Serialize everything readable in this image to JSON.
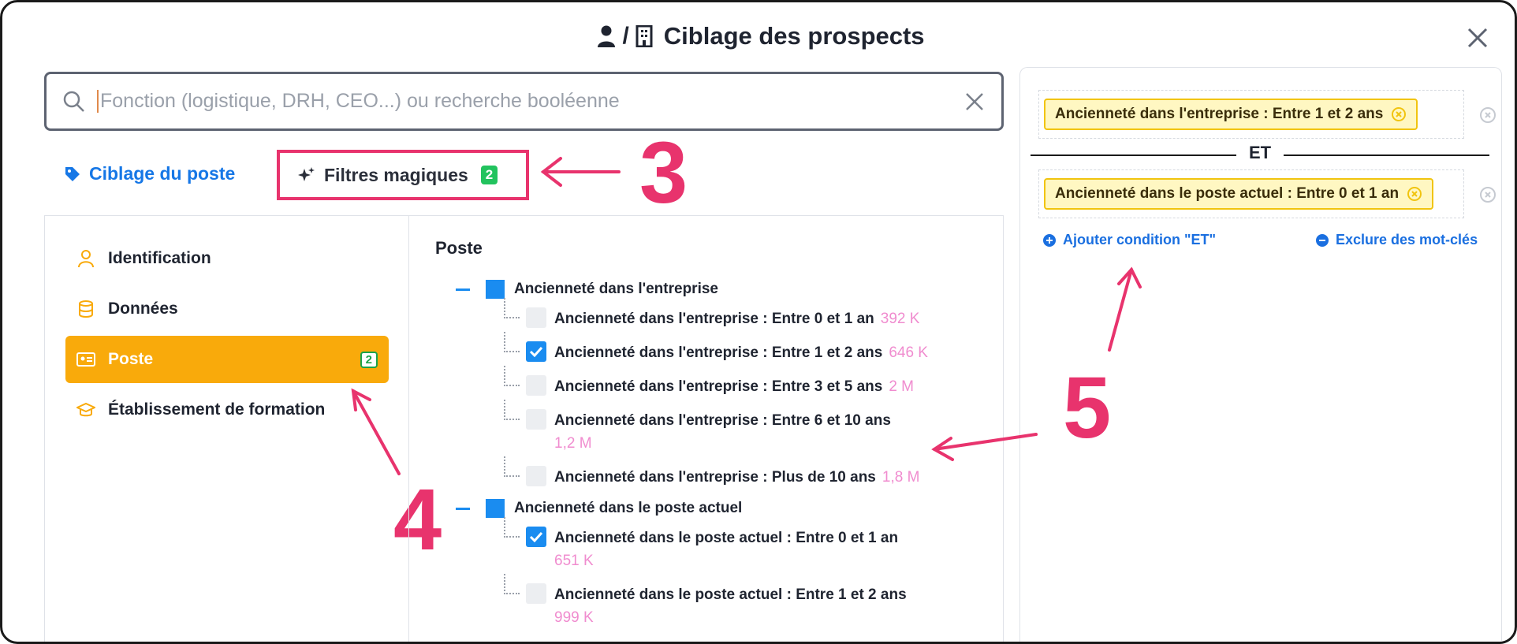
{
  "header": {
    "title": "Ciblage des prospects",
    "separator": "/"
  },
  "search": {
    "placeholder": "Fonction (logistique, DRH, CEO...) ou recherche booléenne"
  },
  "tabs": {
    "ciblage": "Ciblage du poste",
    "filtres": "Filtres magiques",
    "filtres_count": "2"
  },
  "annotations": {
    "three": "3",
    "four": "4",
    "five": "5"
  },
  "sidebar": {
    "items": [
      {
        "label": "Identification",
        "icon": "person-icon"
      },
      {
        "label": "Données",
        "icon": "database-icon"
      },
      {
        "label": "Poste",
        "icon": "id-card-icon",
        "count": "2",
        "active": true
      },
      {
        "label": "Établissement de formation",
        "icon": "graduation-cap-icon"
      }
    ]
  },
  "tree": {
    "title": "Poste",
    "groups": [
      {
        "label": "Ancienneté dans l'entreprise",
        "leaves": [
          {
            "label": "Ancienneté dans l'entreprise : Entre 0 et 1 an",
            "count": "392 K",
            "checked": false
          },
          {
            "label": "Ancienneté dans l'entreprise : Entre 1 et 2 ans",
            "count": "646 K",
            "checked": true
          },
          {
            "label": "Ancienneté dans l'entreprise : Entre 3 et 5 ans",
            "count": "2 M",
            "checked": false
          },
          {
            "label": "Ancienneté dans l'entreprise : Entre 6 et 10 ans",
            "count": "1,2 M",
            "checked": false
          },
          {
            "label": "Ancienneté dans l'entreprise : Plus de 10 ans",
            "count": "1,8 M",
            "checked": false
          }
        ]
      },
      {
        "label": "Ancienneté dans le poste actuel",
        "leaves": [
          {
            "label": "Ancienneté dans le poste actuel : Entre 0 et 1 an",
            "count": "651 K",
            "checked": true
          },
          {
            "label": "Ancienneté dans le poste actuel : Entre 1 et 2 ans",
            "count": "999 K",
            "checked": false
          }
        ]
      }
    ]
  },
  "conditions": {
    "first": "Ancienneté dans l'entreprise : Entre 1 et 2 ans",
    "operator": "ET",
    "second": "Ancienneté dans le poste actuel : Entre 0 et 1 an",
    "add_and": "Ajouter condition \"ET\"",
    "exclude": "Exclure des mot-clés"
  },
  "colors": {
    "accent": "#1677e6",
    "active": "#f9aa0b",
    "annotation": "#e8336d",
    "count": "#f08ccf"
  }
}
